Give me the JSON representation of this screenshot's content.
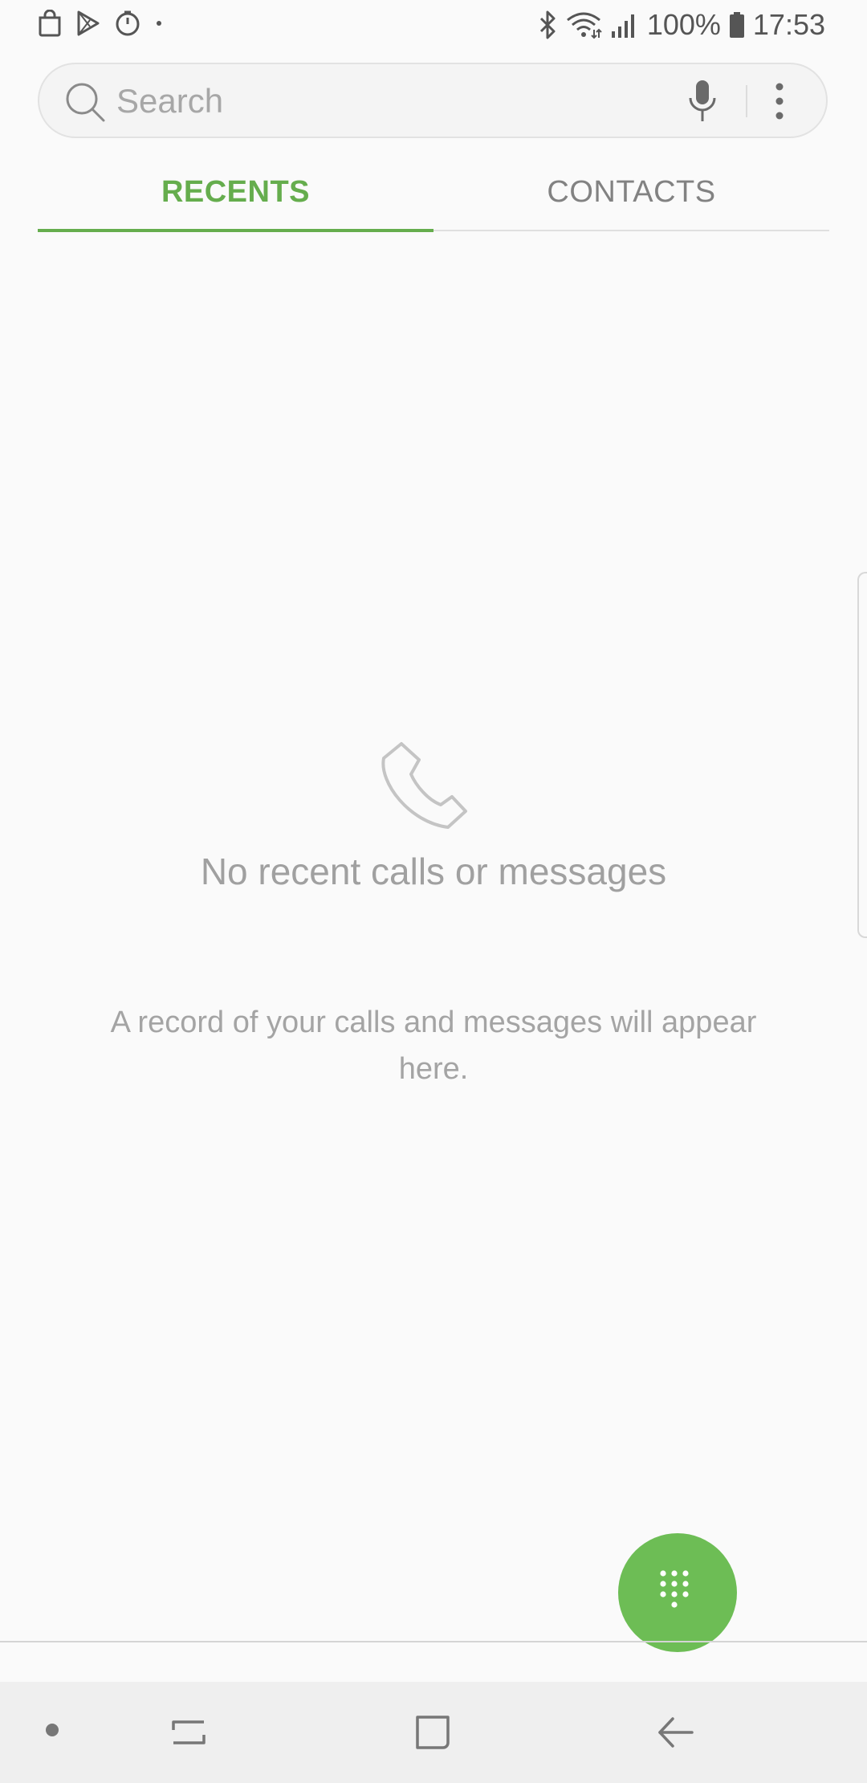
{
  "status_bar": {
    "left_icons": [
      "shopping-bag-icon",
      "play-store-icon",
      "timer-icon",
      "dot-icon"
    ],
    "right_icons": [
      "bluetooth-icon",
      "wifi-icon",
      "signal-icon"
    ],
    "battery": "100%",
    "battery_icon": "battery-icon",
    "time": "17:53"
  },
  "search": {
    "placeholder": "Search",
    "icon": "search-icon",
    "mic_icon": "mic-icon",
    "more_icon": "more-vert-icon"
  },
  "tabs": [
    {
      "label": "RECENTS",
      "active": true
    },
    {
      "label": "CONTACTS",
      "active": false
    }
  ],
  "empty_state": {
    "icon": "phone-icon",
    "title": "No recent calls or messages",
    "description": "A record of your calls and messages will appear here."
  },
  "fab": {
    "icon": "dialpad-icon"
  },
  "nav_bar": {
    "items": [
      "dot-icon",
      "recent-apps-icon",
      "home-icon",
      "back-icon"
    ]
  },
  "colors": {
    "accent": "#65ad4d",
    "fab": "#6dbd55",
    "background": "#fafafa",
    "nav_background": "#efefef"
  }
}
